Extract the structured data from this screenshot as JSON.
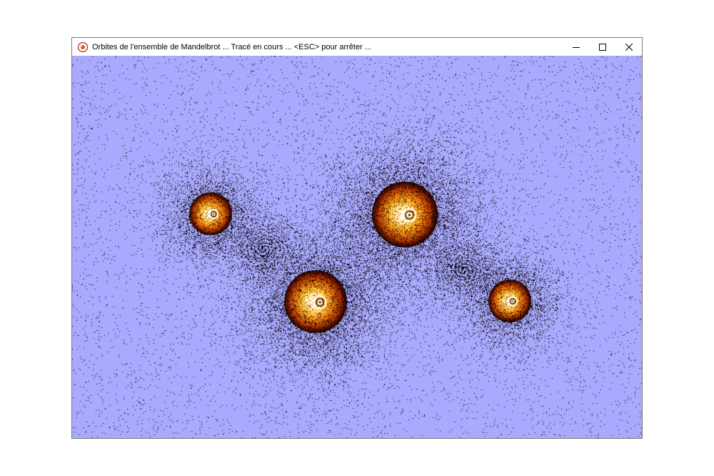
{
  "window": {
    "title": "Orbites de l'ensemble de Mandelbrot ... Tracé en cours ... <ESC> pour arrêter ...",
    "app_icon": "mandelbrot-app-icon",
    "controls": {
      "minimize_icon": "minimize-icon",
      "maximize_icon": "maximize-icon",
      "close_icon": "close-icon"
    }
  },
  "render": {
    "background_color": "#a9a9fd",
    "dot_color": "#000000",
    "palette": [
      "#000000",
      "#5a0e00",
      "#b53a05",
      "#e8780d",
      "#f7c22e",
      "#fff7b0",
      "#ffffff"
    ],
    "blob_count": 4,
    "spiral_count": 2
  }
}
